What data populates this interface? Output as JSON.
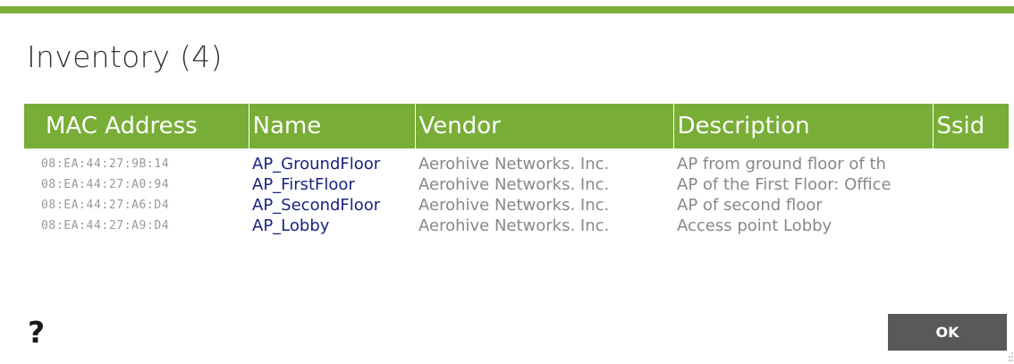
{
  "dialog": {
    "title": "Inventory (4)",
    "accent_color": "#78ae37",
    "help_label": "?",
    "ok_label": "OK",
    "help_icon": "question-mark-icon",
    "resize_icon": "resize-grip-icon"
  },
  "table": {
    "columns": [
      "MAC Address",
      "Name",
      "Vendor",
      "Description",
      "Ssid"
    ],
    "rows": [
      {
        "mac": "08:EA:44:27:9B:14",
        "name": "AP_GroundFloor",
        "vendor": "Aerohive Networks. Inc.",
        "description": "AP from ground floor of th",
        "ssid": ""
      },
      {
        "mac": "08:EA:44:27:A0:94",
        "name": "AP_FirstFloor",
        "vendor": "Aerohive Networks. Inc.",
        "description": "AP of the First Floor: Office",
        "ssid": ""
      },
      {
        "mac": "08:EA:44:27:A6:D4",
        "name": "AP_SecondFloor",
        "vendor": "Aerohive Networks. Inc.",
        "description": "AP of second floor",
        "ssid": ""
      },
      {
        "mac": "08:EA:44:27:A9:D4",
        "name": "AP_Lobby",
        "vendor": "Aerohive Networks. Inc.",
        "description": "Access point Lobby",
        "ssid": ""
      }
    ]
  }
}
